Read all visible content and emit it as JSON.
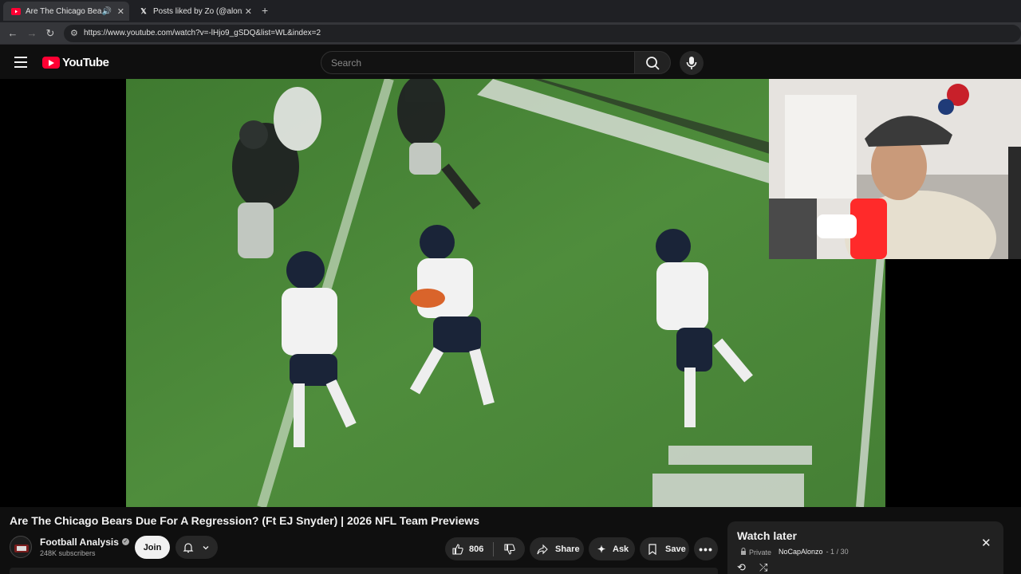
{
  "browser": {
    "tabs": [
      {
        "title": "Are The Chicago Bears Due For A Regression?",
        "favicon": "youtube-icon",
        "active": true
      },
      {
        "title": "Posts liked by Zo (@alonzonem",
        "favicon": "x-icon",
        "active": false
      }
    ],
    "url": "https://www.youtube.com/watch?v=-lHjo9_gSDQ&list=WL&index=2"
  },
  "youtube": {
    "logo_text": "YouTube",
    "search_placeholder": "Search"
  },
  "video": {
    "title": "Are The Chicago Bears Due For A Regression? (Ft EJ Snyder) | 2026 NFL Team Previews",
    "channel_name": "Football Analysis",
    "subscribers": "248K subscribers",
    "join_label": "Join",
    "like_count": "806",
    "share_label": "Share",
    "ask_label": "Ask",
    "save_label": "Save"
  },
  "watch_later": {
    "title": "Watch later",
    "privacy": "Private",
    "owner": "NoCapAlonzo",
    "position": "- 1 / 30"
  },
  "colors": {
    "youtube_red": "#ff0033",
    "field_green": "#4e8a3a",
    "background": "#0f0f0f"
  }
}
